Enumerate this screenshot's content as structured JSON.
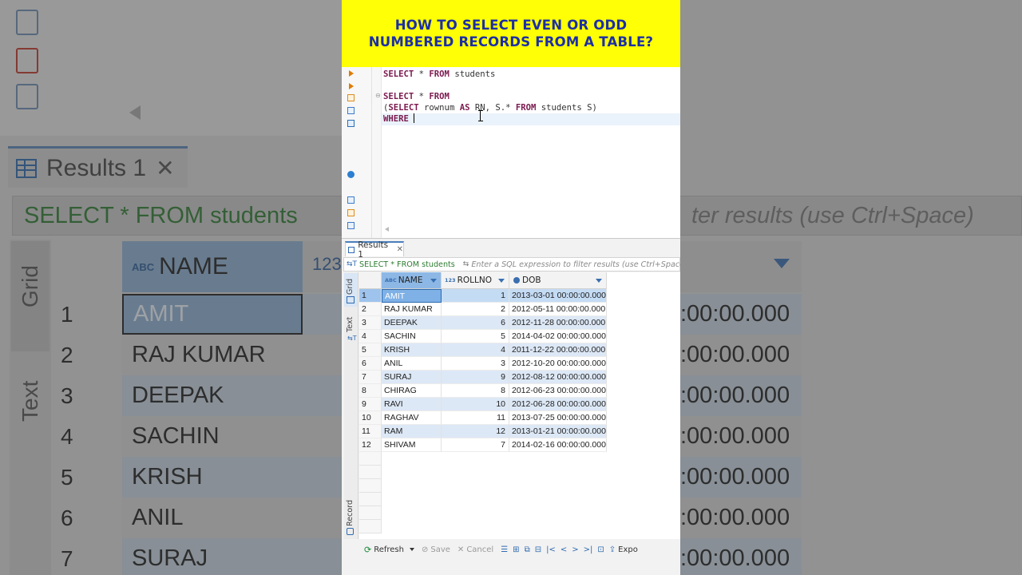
{
  "banner": {
    "line1": "HOW TO SELECT EVEN OR ODD",
    "line2": "NUMBERED RECORDS FROM A TABLE?"
  },
  "editor": {
    "lines": [
      {
        "kw1": "SELECT",
        "mid1": " * ",
        "kw2": "FROM",
        "rest": " students"
      },
      {
        "kw1": "SELECT",
        "mid1": " * ",
        "kw2": "FROM",
        "rest": ""
      },
      {
        "pre": "(",
        "kw1": "SELECT",
        "mid1": " rownum ",
        "kw2": "AS",
        "mid2": " RN, S.* ",
        "kw3": "FROM",
        "rest": " students S)"
      },
      {
        "kw1": "WHERE",
        "rest": " "
      }
    ]
  },
  "results": {
    "tab_label": "Results 1",
    "filter_query": "SELECT * FROM students",
    "filter_placeholder": "Enter a SQL expression to filter results (use Ctrl+Space)",
    "side_tabs": {
      "grid": "Grid",
      "text": "Text",
      "record": "Record"
    },
    "columns": [
      {
        "name": "NAME",
        "type_icon": "ABC"
      },
      {
        "name": "ROLLNO",
        "type_icon": "123"
      },
      {
        "name": "DOB",
        "type_icon": "clock-icon"
      }
    ],
    "rows": [
      {
        "n": "1",
        "name": "AMIT",
        "rollno": "1",
        "dob": "2013-03-01 00:00:00.000"
      },
      {
        "n": "2",
        "name": "RAJ KUMAR",
        "rollno": "2",
        "dob": "2012-05-11 00:00:00.000"
      },
      {
        "n": "3",
        "name": "DEEPAK",
        "rollno": "6",
        "dob": "2012-11-28 00:00:00.000"
      },
      {
        "n": "4",
        "name": "SACHIN",
        "rollno": "5",
        "dob": "2014-04-02 00:00:00.000"
      },
      {
        "n": "5",
        "name": "KRISH",
        "rollno": "4",
        "dob": "2011-12-22 00:00:00.000"
      },
      {
        "n": "6",
        "name": "ANIL",
        "rollno": "3",
        "dob": "2012-10-20 00:00:00.000"
      },
      {
        "n": "7",
        "name": "SURAJ",
        "rollno": "9",
        "dob": "2012-08-12 00:00:00.000"
      },
      {
        "n": "8",
        "name": "CHIRAG",
        "rollno": "8",
        "dob": "2012-06-23 00:00:00.000"
      },
      {
        "n": "9",
        "name": "RAVI",
        "rollno": "10",
        "dob": "2012-06-28 00:00:00.000"
      },
      {
        "n": "10",
        "name": "RAGHAV",
        "rollno": "11",
        "dob": "2013-07-25 00:00:00.000"
      },
      {
        "n": "11",
        "name": "RAM",
        "rollno": "12",
        "dob": "2013-01-21 00:00:00.000"
      },
      {
        "n": "12",
        "name": "SHIVAM",
        "rollno": "7",
        "dob": "2014-02-16 00:00:00.000"
      }
    ],
    "toolbar": {
      "refresh": "Refresh",
      "save": "Save",
      "cancel": "Cancel",
      "export": "Expo"
    }
  },
  "background": {
    "results_tab": "Results 1",
    "filter_query": "SELECT * FROM students",
    "filter_hint": "ter results (use Ctrl+Space)",
    "header_type": "ABC",
    "header_name": "NAME",
    "header_num": "123",
    "side_grid": "Grid",
    "side_text": "Text",
    "time_fragment": ":00:00.000",
    "rows": [
      {
        "n": "1",
        "name": "AMIT"
      },
      {
        "n": "2",
        "name": "RAJ KUMAR"
      },
      {
        "n": "3",
        "name": "DEEPAK"
      },
      {
        "n": "4",
        "name": "SACHIN"
      },
      {
        "n": "5",
        "name": "KRISH"
      },
      {
        "n": "6",
        "name": "ANIL"
      },
      {
        "n": "7",
        "name": "SURAJ"
      }
    ]
  },
  "colors": {
    "banner_bg": "#ffff05",
    "banner_text": "#1c2fa5",
    "keyword": "#7b1a4f",
    "filter_query": "#2e7d32",
    "selection": "#7fb1e6"
  }
}
